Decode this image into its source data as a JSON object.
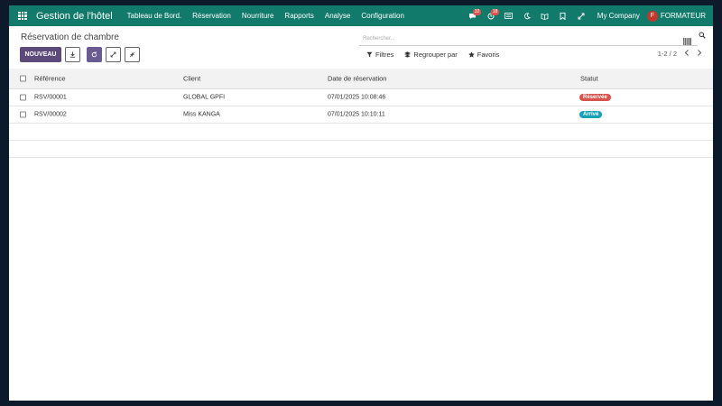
{
  "navbar": {
    "brand": "Gestion de l'hôtel",
    "menu": [
      "Tableau de Bord.",
      "Réservation",
      "Nourriture",
      "Rapports",
      "Analyse",
      "Configuration"
    ],
    "chat_badge": "32",
    "activity_badge": "18",
    "company": "My Company",
    "user_initial": "F",
    "user_name": "FORMATEUR"
  },
  "control_panel": {
    "breadcrumb": "Réservation de chambre",
    "search_placeholder": "Rechercher...",
    "new_label": "NOUVEAU",
    "filters_label": "Filtres",
    "group_label": "Regrouper par",
    "favorites_label": "Favoris",
    "pager": "1-2 / 2"
  },
  "table": {
    "headers": [
      "Référence",
      "Client",
      "Date de réservation",
      "Statut"
    ],
    "rows": [
      {
        "ref": "RSV/00001",
        "client": "GLOBAL GPFI",
        "date": "07/01/2025 10:08:46",
        "status": "Réservée",
        "status_color": "#d9534f"
      },
      {
        "ref": "RSV/00002",
        "client": "Miss KANGA",
        "date": "07/01/2025 10:10:11",
        "status": "Arrivé",
        "status_color": "#17a2b8"
      }
    ]
  },
  "colors": {
    "navbar": "#117a6b",
    "primary": "#5c4a7a"
  }
}
